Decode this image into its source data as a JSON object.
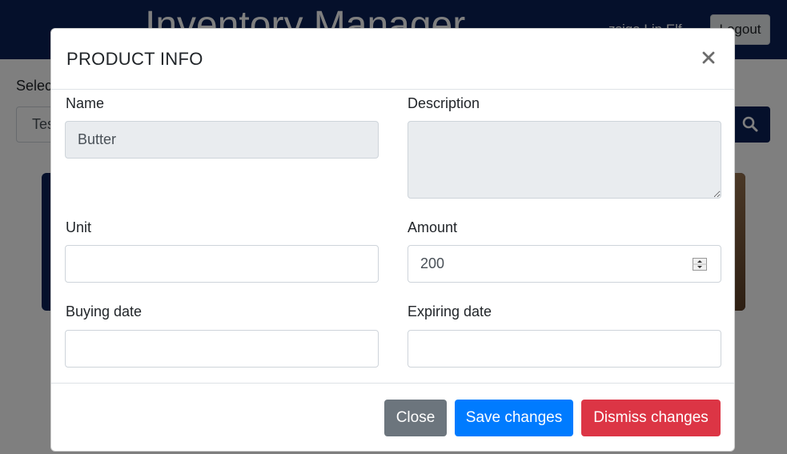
{
  "navbar": {
    "app_title": "Inventory Manager",
    "user_name": "zsiga Lip Elf",
    "logout_label": "Logout"
  },
  "background": {
    "select_label": "Selec",
    "search_value": "Tes",
    "search_icon": "search-icon"
  },
  "modal": {
    "title": "PRODUCT INFO",
    "close_icon": "close-icon",
    "fields": {
      "name": {
        "label": "Name",
        "value": "Butter"
      },
      "description": {
        "label": "Description",
        "value": ""
      },
      "unit": {
        "label": "Unit",
        "value": ""
      },
      "amount": {
        "label": "Amount",
        "value": "200"
      },
      "buying_date": {
        "label": "Buying date",
        "value": ""
      },
      "expiring_date": {
        "label": "Expiring date",
        "value": ""
      }
    },
    "footer": {
      "close_label": "Close",
      "save_label": "Save changes",
      "dismiss_label": "Dismiss changes"
    }
  },
  "colors": {
    "navbar": "#0b2157",
    "close_button": "#6c757d",
    "save_button": "#007bff",
    "dismiss_button": "#dc3545",
    "readonly_field": "#e9ecef"
  }
}
